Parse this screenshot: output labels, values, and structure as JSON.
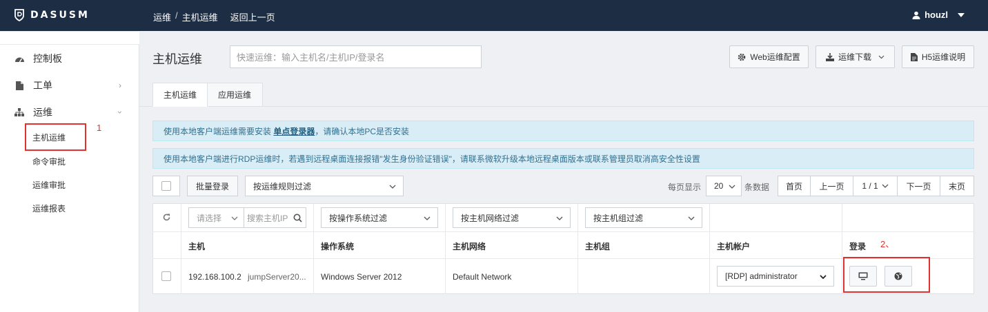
{
  "app": {
    "brand": "DASUSM"
  },
  "breadcrumb": {
    "part1": "运维",
    "sep": "/",
    "part2": "主机运维",
    "back": "返回上一页"
  },
  "user": {
    "name": "houzl"
  },
  "sidebar": {
    "items": [
      {
        "label": "控制板"
      },
      {
        "label": "工单"
      },
      {
        "label": "运维"
      }
    ],
    "subitems": [
      {
        "label": "主机运维"
      },
      {
        "label": "命令审批"
      },
      {
        "label": "运维审批"
      },
      {
        "label": "运维报表"
      }
    ]
  },
  "annotations": {
    "mark1": "1",
    "mark2": "2、"
  },
  "page": {
    "title": "主机运维",
    "quick_placeholder": "快速运维：输入主机名/主机IP/登录名",
    "btn_web_config": "Web运维配置",
    "btn_download": "运维下载",
    "btn_h5": "H5运维说明"
  },
  "tabs": [
    {
      "label": "主机运维"
    },
    {
      "label": "应用运维"
    }
  ],
  "alerts": {
    "a1_pre": "使用本地客户端运维需要安装 ",
    "a1_link": "单点登录器",
    "a1_post": "，请确认本地PC是否安装",
    "a2": "使用本地客户端进行RDP运维时，若遇到远程桌面连接报错\"发生身份验证错误\"，请联系微软升级本地远程桌面版本或联系管理员取消高安全性设置"
  },
  "toolbar": {
    "batch_login": "批量登录",
    "rule_filter": "按运维规则过滤",
    "per_page_label": "每页显示",
    "per_page": "20",
    "records_label": "条数据",
    "first": "首页",
    "prev": "上一页",
    "page_indicator": "1 / 1",
    "next": "下一页",
    "last": "末页"
  },
  "filters": {
    "select_placeholder": "请选择",
    "search_placeholder": "搜索主机IP",
    "os_filter": "按操作系统过滤",
    "network_filter": "按主机网络过滤",
    "group_filter": "按主机组过滤"
  },
  "table": {
    "headers": {
      "host": "主机",
      "os": "操作系统",
      "network": "主机网络",
      "group": "主机组",
      "account": "主机帐户",
      "login": "登录"
    },
    "rows": [
      {
        "ip": "192.168.100.2",
        "name": "jumpServer20...",
        "os": "Windows Server 2012",
        "network": "Default Network",
        "group": "",
        "account": "[RDP] administrator"
      }
    ]
  }
}
